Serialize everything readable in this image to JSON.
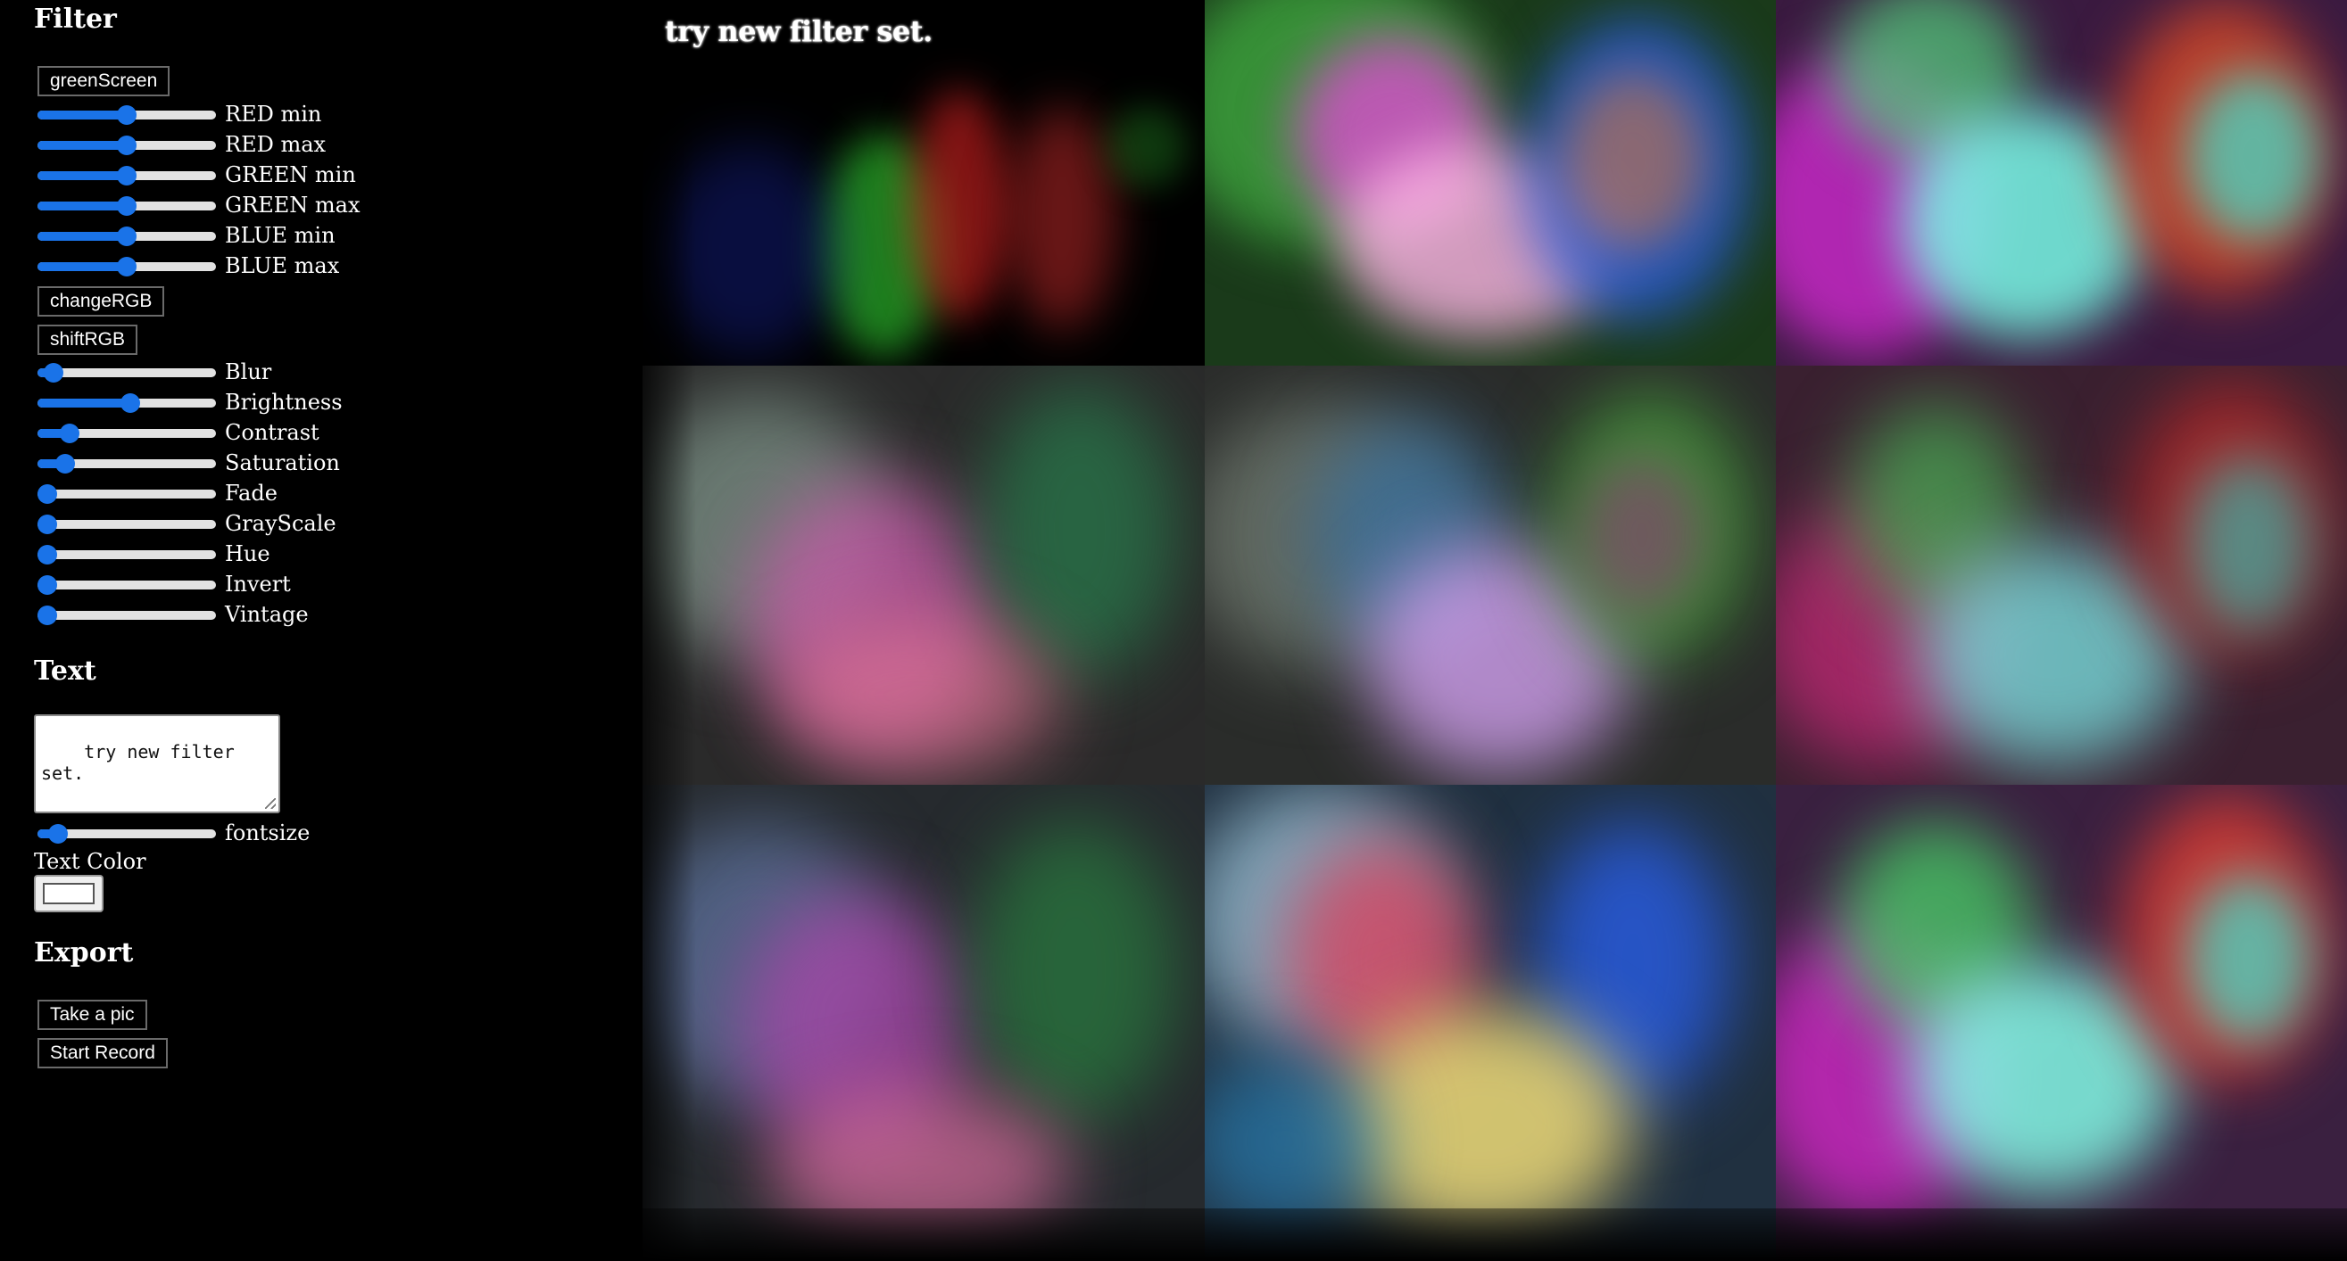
{
  "filter": {
    "title": "Filter",
    "green_screen_label": "greenScreen",
    "rgb_sliders": [
      {
        "label": "RED min",
        "value": 0.5
      },
      {
        "label": "RED max",
        "value": 0.5
      },
      {
        "label": "GREEN min",
        "value": 0.5
      },
      {
        "label": "GREEN max",
        "value": 0.5
      },
      {
        "label": "BLUE min",
        "value": 0.5
      },
      {
        "label": "BLUE max",
        "value": 0.5
      }
    ],
    "change_rgb_label": "changeRGB",
    "shift_rgb_label": "shiftRGB",
    "effect_sliders": [
      {
        "label": "Blur",
        "value": 0.04
      },
      {
        "label": "Brightness",
        "value": 0.52
      },
      {
        "label": "Contrast",
        "value": 0.14
      },
      {
        "label": "Saturation",
        "value": 0.11
      },
      {
        "label": "Fade",
        "value": 0.0
      },
      {
        "label": "GrayScale",
        "value": 0.0
      },
      {
        "label": "Hue",
        "value": 0.0
      },
      {
        "label": "Invert",
        "value": 0.0
      },
      {
        "label": "Vintage",
        "value": 0.0
      }
    ]
  },
  "text": {
    "title": "Text",
    "textarea_value": "try new filter set.",
    "fontsize_label": "fontsize",
    "fontsize_value": 0.07,
    "text_color_label": "Text Color",
    "text_color_value": "#ffffff"
  },
  "export": {
    "title": "Export",
    "take_pic_label": "Take a pic",
    "start_record_label": "Start Record"
  },
  "preview": {
    "overlay_text": "try new filter set."
  },
  "colors": {
    "accent": "#1a73e8",
    "background": "#000000"
  }
}
